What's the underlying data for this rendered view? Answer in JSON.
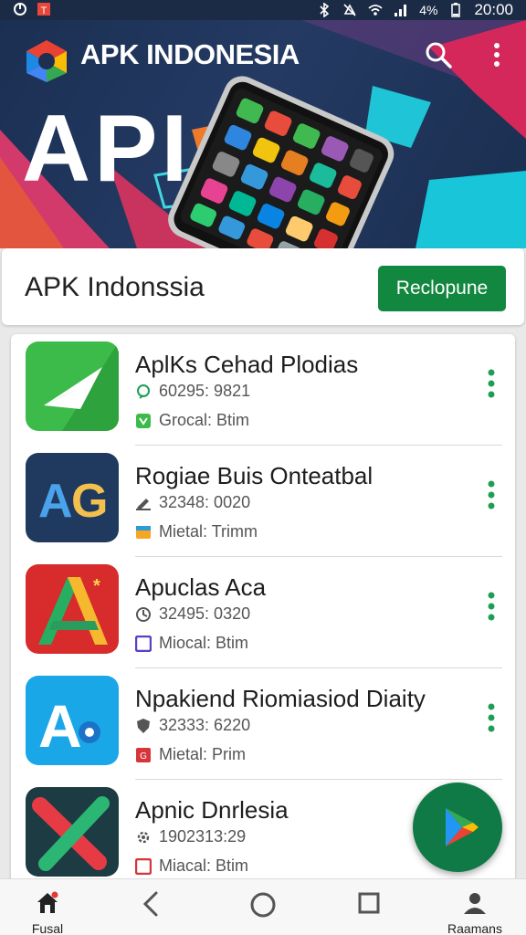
{
  "status_bar": {
    "left_icons": [
      "app-notification-icon",
      "app-notification-icon-2"
    ],
    "battery": "4%",
    "time": "20:00"
  },
  "hero": {
    "app_title": "APK INDONESIA",
    "big_text": "API"
  },
  "header": {
    "title": "APK Indonssia",
    "cta_label": "Reclopune",
    "cta_color": "#12873f"
  },
  "apps": [
    {
      "name": "AplKs Cehad Plodias",
      "stat": "60295: 9821",
      "category": "Grocal: Btim"
    },
    {
      "name": "Rogiae Buis Onteatbal",
      "stat": "32348: 0020",
      "category": "Mietal: Trimm"
    },
    {
      "name": "Apuclas Aca",
      "stat": "32495: 0320",
      "category": "Miocal: Btim"
    },
    {
      "name": "Npakiend Riomiasiod Diaity",
      "stat": "32333: 6220",
      "category": "Mietal: Prim"
    },
    {
      "name": "Apnic Dnrlesia",
      "stat": "1902313:29",
      "category": "Miacal: Btim"
    }
  ],
  "nav": {
    "home_label": "Fusal",
    "profile_label": "Raamans"
  },
  "colors": {
    "accent": "#12873f",
    "fab": "#0f7a46"
  }
}
